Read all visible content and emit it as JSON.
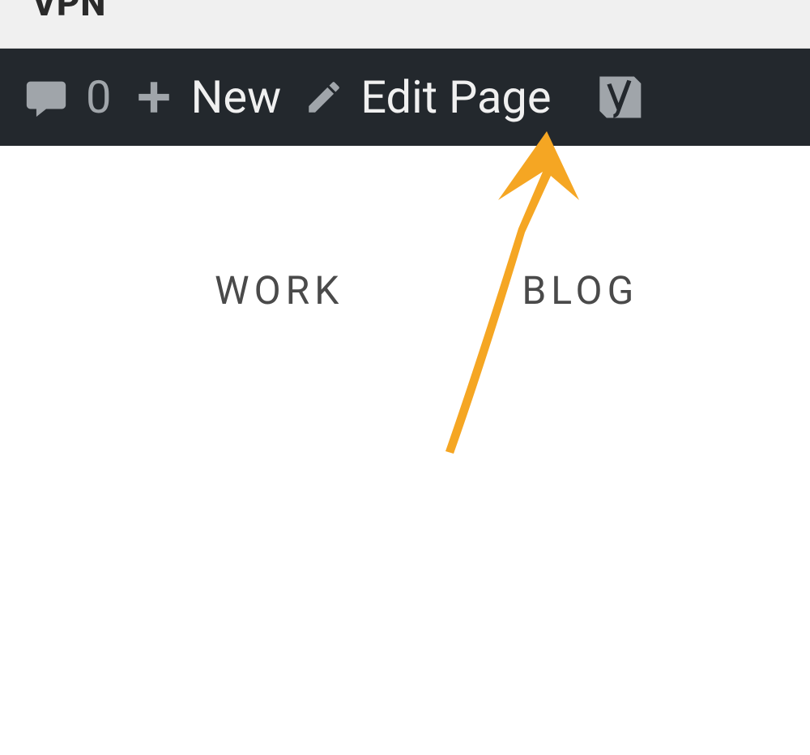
{
  "topbar": {
    "text": "VPN"
  },
  "adminbar": {
    "comments_count": "0",
    "new_label": "New",
    "edit_label": "Edit Page"
  },
  "nav": {
    "work": "WORK",
    "blog": "BLOG"
  },
  "colors": {
    "adminbar_bg": "#23282d",
    "icon_fill": "#a0a5aa",
    "arrow": "#f5a623",
    "nav_text": "#4a4a4a"
  }
}
